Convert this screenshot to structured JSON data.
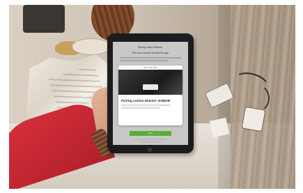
{
  "tablet": {
    "header_title": "Pairing Lutron Dimmer-",
    "subtitle": "Pair your devices through the app",
    "modal_title": "Pairing Leviton Dimmer- E308AB",
    "modal_bar": "Scan QR code",
    "primary_button": "Next"
  }
}
